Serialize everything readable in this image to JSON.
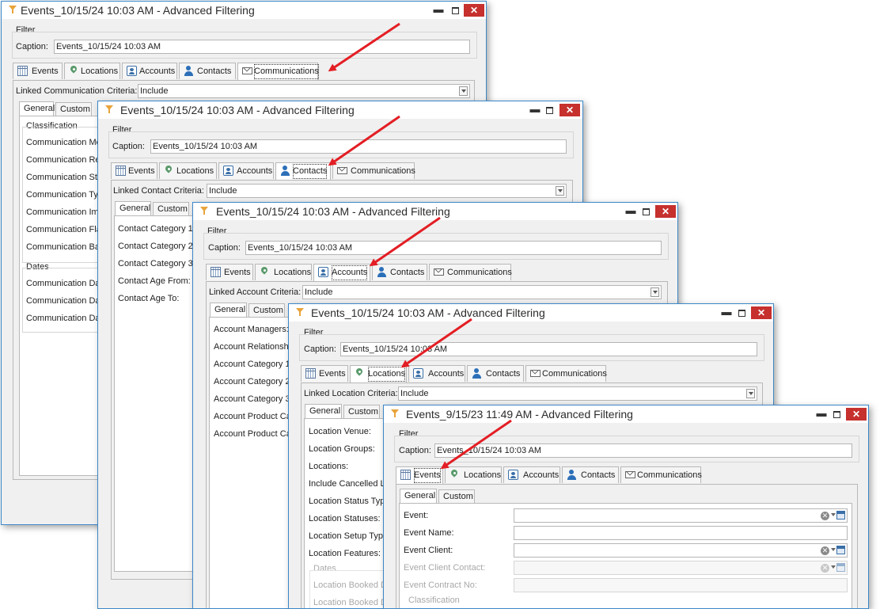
{
  "colors": {
    "border": "#3c87c8",
    "close": "#c6302d",
    "arrow": "#e31e24"
  },
  "windows": [
    {
      "title": "Events_10/15/24 10:03 AM - Advanced Filtering",
      "filter_label": "Filter",
      "caption_label": "Caption:",
      "caption_value": "Events_10/15/24 10:03 AM",
      "tabs": [
        "Events",
        "Locations",
        "Accounts",
        "Contacts",
        "Communications"
      ],
      "selected_tab": "Communications",
      "criteria_label": "Linked Communication Criteria:",
      "criteria_value": "Include",
      "subtabs": [
        "General",
        "Custom"
      ],
      "sections": {
        "classification": "Classification",
        "dates": "Dates"
      },
      "fields": [
        "Communication Me",
        "Communication Re",
        "Communication Sta",
        "Communication Typ",
        "Communication Imp",
        "Communication Fla",
        "Communication Bat"
      ],
      "date_fields": [
        "Communication Dat",
        "Communication Dat",
        "Communication Dat"
      ]
    },
    {
      "title": "Events_10/15/24 10:03 AM - Advanced Filtering",
      "filter_label": "Filter",
      "caption_label": "Caption:",
      "caption_value": "Events_10/15/24 10:03 AM",
      "tabs": [
        "Events",
        "Locations",
        "Accounts",
        "Contacts",
        "Communications"
      ],
      "selected_tab": "Contacts",
      "criteria_label": "Linked Contact Criteria:",
      "criteria_value": "Include",
      "subtabs": [
        "General",
        "Custom"
      ],
      "fields": [
        "Contact Category 1",
        "Contact Category 2",
        "Contact Category 3",
        "Contact Age From:",
        "Contact Age To:"
      ]
    },
    {
      "title": "Events_10/15/24 10:03 AM - Advanced Filtering",
      "filter_label": "Filter",
      "caption_label": "Caption:",
      "caption_value": "Events_10/15/24 10:03 AM",
      "tabs": [
        "Events",
        "Locations",
        "Accounts",
        "Contacts",
        "Communications"
      ],
      "selected_tab": "Accounts",
      "criteria_label": "Linked Account Criteria:",
      "criteria_value": "Include",
      "subtabs": [
        "General",
        "Custom"
      ],
      "fields": [
        "Account Managers:",
        "Account Relationshi",
        "Account Category 1",
        "Account Category 2",
        "Account Category 3",
        "Account Product Ca",
        "Account Product Ca"
      ]
    },
    {
      "title": "Events_10/15/24 10:03 AM - Advanced Filtering",
      "filter_label": "Filter",
      "caption_label": "Caption:",
      "caption_value": "Events_10/15/24 10:03 AM",
      "tabs": [
        "Events",
        "Locations",
        "Accounts",
        "Contacts",
        "Communications"
      ],
      "selected_tab": "Locations",
      "criteria_label": "Linked Location Criteria:",
      "criteria_value": "Include",
      "subtabs": [
        "General",
        "Custom"
      ],
      "fields": [
        "Location Venue:",
        "Location Groups:",
        "Locations:",
        "Include Cancelled Lo",
        "Location Status Typ",
        "Location Statuses:",
        "Location Setup Type",
        "Location Features:"
      ],
      "sections": {
        "dates": "Dates"
      },
      "date_fields": [
        "Location Booked D",
        "Location Booked D"
      ]
    },
    {
      "title": "Events_9/15/23 11:49 AM - Advanced Filtering",
      "filter_label": "Filter",
      "caption_label": "Caption:",
      "caption_value": "Events_10/15/24 10:03 AM",
      "tabs": [
        "Events",
        "Locations",
        "Accounts",
        "Contacts",
        "Communications"
      ],
      "selected_tab": "Events",
      "subtabs": [
        "General",
        "Custom"
      ],
      "fields": [
        "Event:",
        "Event Name:",
        "Event Client:",
        "Event Client Contact:",
        "Event Contract No:"
      ],
      "sections": {
        "classification": "Classification"
      }
    }
  ]
}
